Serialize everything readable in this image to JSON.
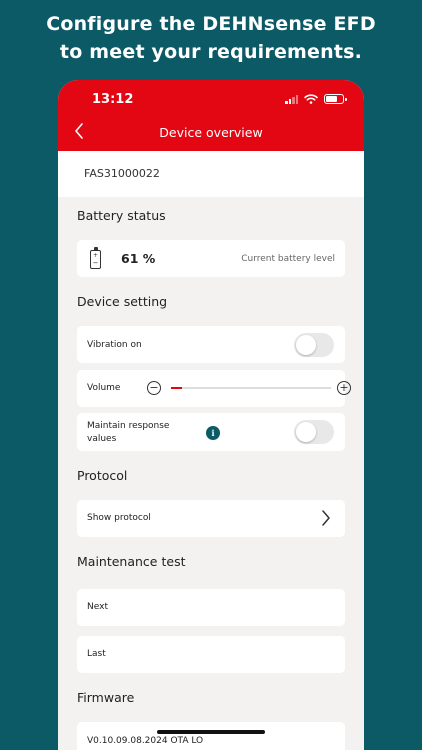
{
  "headline": {
    "line1": "Configure the DEHNsense EFD",
    "line2": "to meet your requirements."
  },
  "status_bar": {
    "time": "13:12"
  },
  "nav": {
    "back_icon": "chevron-left-icon",
    "title": "Device overview"
  },
  "device": {
    "serial": "FAS31000022"
  },
  "battery": {
    "section_title": "Battery status",
    "value": "61 %",
    "caption": "Current battery level",
    "icon": "battery-icon"
  },
  "device_setting": {
    "section_title": "Device setting",
    "vibration": {
      "label": "Vibration on",
      "on": false
    },
    "volume": {
      "label": "Volume",
      "level": 0.07,
      "minus": "−",
      "plus": "+"
    },
    "maintain": {
      "label_line1": "Maintain response",
      "label_line2": "values",
      "on": false,
      "info": "i"
    }
  },
  "protocol": {
    "section_title": "Protocol",
    "show_label": "Show protocol"
  },
  "maintenance": {
    "section_title": "Maintenance test",
    "next_label": "Next",
    "last_label": "Last"
  },
  "firmware": {
    "section_title": "Firmware",
    "version": "V0.10.09.08.2024 OTA LO"
  },
  "colors": {
    "background": "#0b5a66",
    "header_red": "#e30613",
    "content_bg": "#f4f2f1",
    "info_teal": "#0b5a66"
  }
}
